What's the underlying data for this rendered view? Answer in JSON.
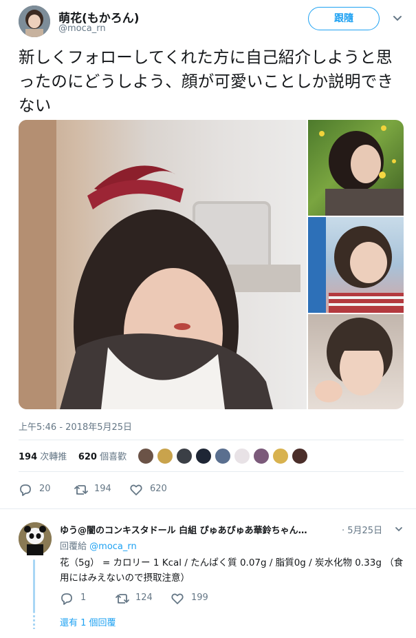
{
  "tweet": {
    "author_name": "萌花(もかろん)",
    "author_handle": "@moca_rn",
    "follow_label": "跟隨",
    "text": "新しくフォローしてくれた方に自己紹介しようと思ったのにどうしよう、顔が可愛いことしか説明できない",
    "timestamp": "上午5:46 - 2018年5月25日",
    "retweets_count": "194",
    "retweets_label": "次轉推",
    "likes_count": "620",
    "likes_label": "個喜歡",
    "reply_action_count": "20",
    "retweet_action_count": "194",
    "like_action_count": "620"
  },
  "reply": {
    "author_line": "ゆう@闇のコンキスタドール 白組 ぴゅあぴゅあ華鈴ちゃん…",
    "date": "· 5月25日",
    "reply_to_label": "回覆給",
    "reply_to_handle": "@moca_rn",
    "text": "花（5g） = カロリー 1 Kcal / たんぱく質 0.07g / 脂質0g / 炭水化物 0.33g （食用にはみえないので摂取注意）",
    "reply_count": "1",
    "retweet_count": "124",
    "like_count": "199",
    "more_replies_label": "還有 1 個回覆"
  },
  "colors": {
    "accent": "#1da1f2",
    "muted": "#657786",
    "thread_line": "#a8d6f5"
  },
  "icons": {
    "reply": "speech-bubble-icon",
    "retweet": "retweet-arrows-icon",
    "like": "heart-icon",
    "more": "chevron-down-icon"
  }
}
